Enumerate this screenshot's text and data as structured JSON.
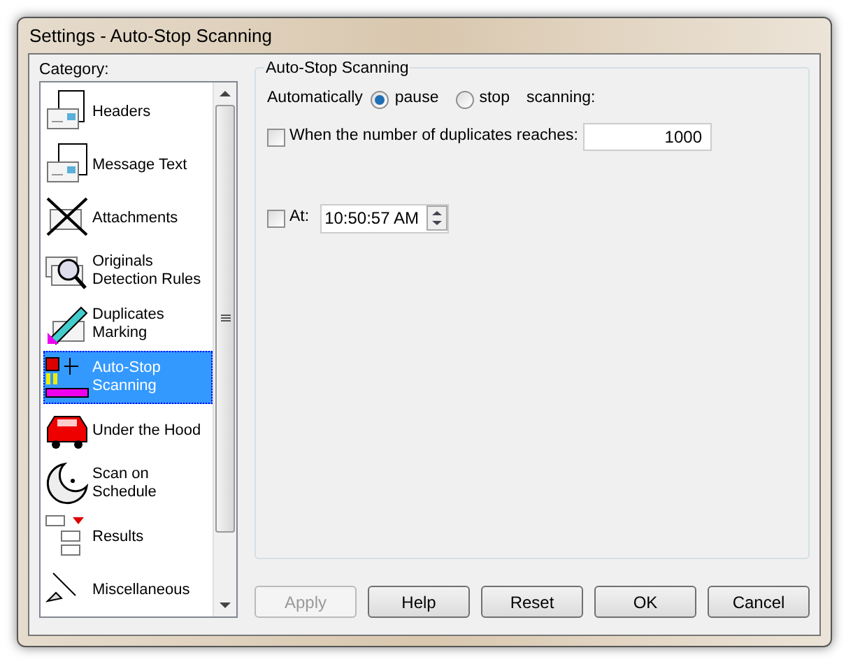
{
  "window": {
    "title": "Settings - Auto-Stop Scanning"
  },
  "category": {
    "label": "Category:",
    "items": [
      {
        "label": "Headers",
        "selected": false
      },
      {
        "label": "Message Text",
        "selected": false
      },
      {
        "label": "Attachments",
        "selected": false
      },
      {
        "label": "Originals Detection Rules",
        "selected": false
      },
      {
        "label": "Duplicates Marking",
        "selected": false
      },
      {
        "label": "Auto-Stop Scanning",
        "selected": true
      },
      {
        "label": "Under the Hood",
        "selected": false
      },
      {
        "label": "Scan on Schedule",
        "selected": false
      },
      {
        "label": "Results",
        "selected": false
      },
      {
        "label": "Miscellaneous",
        "selected": false
      }
    ]
  },
  "group": {
    "title": "Auto-Stop Scanning",
    "prefix": "Automatically",
    "options": [
      {
        "label": "pause",
        "selected": true
      },
      {
        "label": "stop",
        "selected": false
      }
    ],
    "suffix": "scanning:",
    "duplicates": {
      "label": "When the number of duplicates reaches:",
      "checked": false,
      "value": "1000"
    },
    "at": {
      "label": "At:",
      "checked": false,
      "value": "10:50:57 AM"
    }
  },
  "buttons": [
    {
      "label": "Apply",
      "disabled": true
    },
    {
      "label": "Help",
      "disabled": false
    },
    {
      "label": "Reset",
      "disabled": false
    },
    {
      "label": "OK",
      "disabled": false
    },
    {
      "label": "Cancel",
      "disabled": false
    }
  ]
}
